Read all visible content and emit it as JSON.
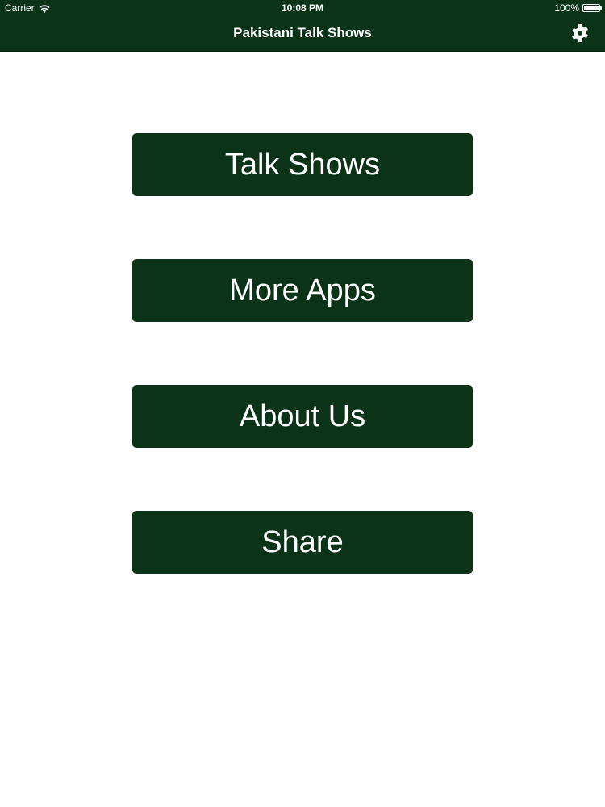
{
  "status_bar": {
    "carrier": "Carrier",
    "time": "10:08 PM",
    "battery": "100%"
  },
  "nav_bar": {
    "title": "Pakistani Talk Shows",
    "settings_icon": "gear-icon"
  },
  "menu": {
    "talk_shows": "Talk Shows",
    "more_apps": "More Apps",
    "about_us": "About Us",
    "share": "Share"
  },
  "colors": {
    "primary_green": "#0a3317",
    "button_text": "#ffffff",
    "background": "#ffffff"
  }
}
